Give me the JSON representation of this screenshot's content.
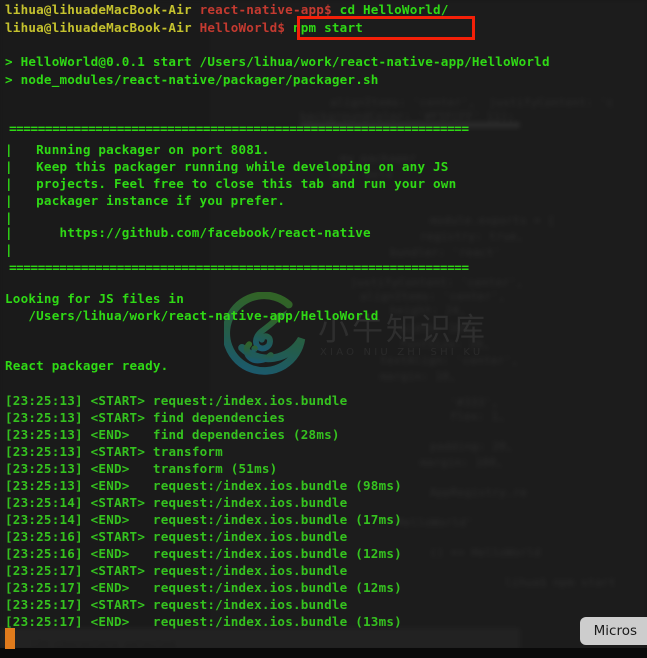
{
  "window": {
    "title": "Terminal — react-native packager",
    "background_color": "#1a1a1a"
  },
  "colors": {
    "prompt_user": "#c5c22e",
    "prompt_cwd": "#c43a30",
    "output_green": "#2fd915",
    "log_green": "#35c21f",
    "highlight_box": "#f32008",
    "cursor": "#e07b1c",
    "chip_bg": "#cdcdcd"
  },
  "prompts": [
    {
      "user_host": "lihua@lihuadeMacBook-Air",
      "cwd": "react-native-app$",
      "command": "cd HelloWorld/",
      "highlighted": false
    },
    {
      "user_host": "lihua@lihuadeMacBook-Air",
      "cwd": "HelloWorld$",
      "command": "npm start",
      "highlighted": true
    }
  ],
  "npm_output": [
    "> HelloWorld@0.0.1 start /Users/lihua/work/react-native-app/HelloWorld",
    "> node_modules/react-native/packager/packager.sh"
  ],
  "banner": {
    "rule": "================================================================",
    "lines": [
      "|   Running packager on port 8081.",
      "|   Keep this packager running while developing on any JS",
      "|   projects. Feel free to close this tab and run your own",
      "|   packager instance if you prefer.",
      "|",
      "|      https://github.com/facebook/react-native",
      "|"
    ]
  },
  "scan": {
    "heading": "Looking for JS files in",
    "path": "   /Users/lihua/work/react-native-app/HelloWorld",
    "ready": "React packager ready."
  },
  "log": [
    {
      "time": "[23:25:13]",
      "tag": "<START>",
      "message": "request:/index.ios.bundle"
    },
    {
      "time": "[23:25:13]",
      "tag": "<START>",
      "message": "find dependencies"
    },
    {
      "time": "[23:25:13]",
      "tag": "<END>",
      "message": "  find dependencies (28ms)"
    },
    {
      "time": "[23:25:13]",
      "tag": "<START>",
      "message": "transform"
    },
    {
      "time": "[23:25:13]",
      "tag": "<END>",
      "message": "  transform (51ms)"
    },
    {
      "time": "[23:25:13]",
      "tag": "<END>",
      "message": "  request:/index.ios.bundle (98ms)"
    },
    {
      "time": "[23:25:14]",
      "tag": "<START>",
      "message": "request:/index.ios.bundle"
    },
    {
      "time": "[23:25:14]",
      "tag": "<END>",
      "message": "  request:/index.ios.bundle (17ms)"
    },
    {
      "time": "[23:25:16]",
      "tag": "<START>",
      "message": "request:/index.ios.bundle"
    },
    {
      "time": "[23:25:16]",
      "tag": "<END>",
      "message": "  request:/index.ios.bundle (12ms)"
    },
    {
      "time": "[23:25:17]",
      "tag": "<START>",
      "message": "request:/index.ios.bundle"
    },
    {
      "time": "[23:25:17]",
      "tag": "<END>",
      "message": "  request:/index.ios.bundle (12ms)"
    },
    {
      "time": "[23:25:17]",
      "tag": "<START>",
      "message": "request:/index.ios.bundle"
    },
    {
      "time": "[23:25:17]",
      "tag": "<END>",
      "message": "  request:/index.ios.bundle (13ms)"
    }
  ],
  "taskbar_chip": {
    "label": "Micros"
  },
  "watermark": {
    "chinese": "小牛知识库",
    "pinyin": "XIAO NIU ZHI SHI KU",
    "logo_colors": [
      "#3f8f2e",
      "#1b7fa0"
    ]
  }
}
